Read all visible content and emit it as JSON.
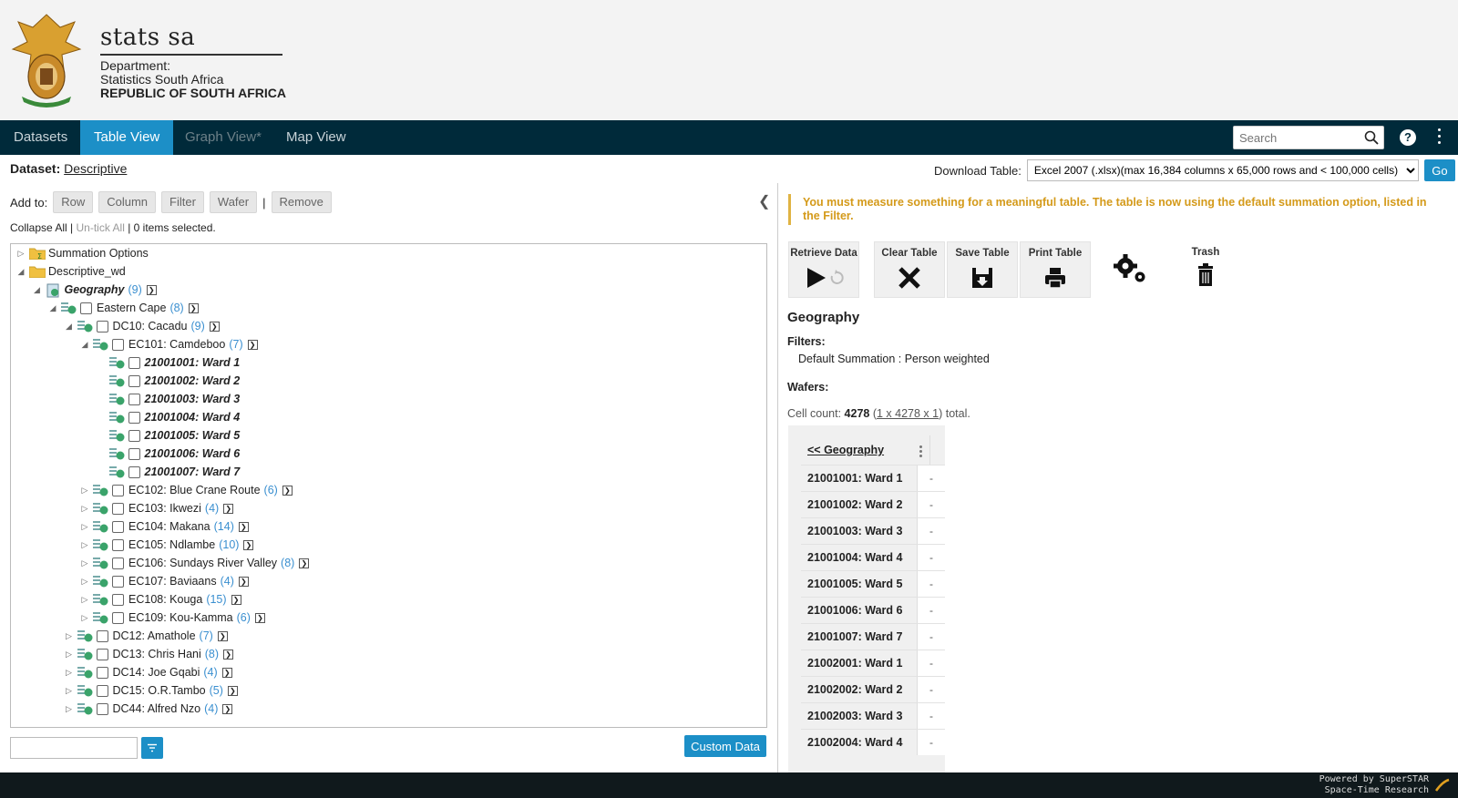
{
  "header": {
    "brand": "stats sa",
    "dept_line1": "Department:",
    "dept_line2": "Statistics South Africa",
    "dept_line3": "REPUBLIC OF SOUTH AFRICA"
  },
  "nav": {
    "tabs": [
      {
        "label": "Datasets",
        "state": "normal"
      },
      {
        "label": "Table View",
        "state": "active"
      },
      {
        "label": "Graph View*",
        "state": "disabled"
      },
      {
        "label": "Map View",
        "state": "normal"
      }
    ],
    "search_placeholder": "Search",
    "help_label": "?"
  },
  "dataset": {
    "label": "Dataset:",
    "name": "Descriptive"
  },
  "download": {
    "label": "Download Table:",
    "selected": "Excel 2007 (.xlsx)(max 16,384 columns x 65,000 rows and < 100,000 cells)",
    "go": "Go"
  },
  "add_to": {
    "label": "Add to:",
    "buttons": [
      "Row",
      "Column",
      "Filter",
      "Wafer"
    ],
    "separator": "|",
    "remove": "Remove"
  },
  "tree_controls": {
    "collapse_all": "Collapse All",
    "untick_all": "Un-tick All",
    "selected_text": "0 items selected."
  },
  "tree": [
    {
      "label": "Summation Options",
      "count": "",
      "style": "normal"
    },
    {
      "label": "Descriptive_wd",
      "count": "",
      "style": "normal"
    },
    {
      "label": "Geography",
      "count": "(9)",
      "style": "bolditalic"
    },
    {
      "label": "Eastern Cape",
      "count": "(8)",
      "style": "normal"
    },
    {
      "label": "DC10: Cacadu",
      "count": "(9)",
      "style": "normal"
    },
    {
      "label": "EC101: Camdeboo",
      "count": "(7)",
      "style": "normal"
    },
    {
      "label": "21001001: Ward 1",
      "count": "",
      "style": "bolditalic"
    },
    {
      "label": "21001002: Ward 2",
      "count": "",
      "style": "bolditalic"
    },
    {
      "label": "21001003: Ward 3",
      "count": "",
      "style": "bolditalic"
    },
    {
      "label": "21001004: Ward 4",
      "count": "",
      "style": "bolditalic"
    },
    {
      "label": "21001005: Ward 5",
      "count": "",
      "style": "bolditalic"
    },
    {
      "label": "21001006: Ward 6",
      "count": "",
      "style": "bolditalic"
    },
    {
      "label": "21001007: Ward 7",
      "count": "",
      "style": "bolditalic"
    },
    {
      "label": "EC102: Blue Crane Route",
      "count": "(6)",
      "style": "normal"
    },
    {
      "label": "EC103: Ikwezi",
      "count": "(4)",
      "style": "normal"
    },
    {
      "label": "EC104: Makana",
      "count": "(14)",
      "style": "normal"
    },
    {
      "label": "EC105: Ndlambe",
      "count": "(10)",
      "style": "normal"
    },
    {
      "label": "EC106: Sundays River Valley",
      "count": "(8)",
      "style": "normal"
    },
    {
      "label": "EC107: Baviaans",
      "count": "(4)",
      "style": "normal"
    },
    {
      "label": "EC108: Kouga",
      "count": "(15)",
      "style": "normal"
    },
    {
      "label": "EC109: Kou-Kamma",
      "count": "(6)",
      "style": "normal"
    },
    {
      "label": "DC12: Amathole",
      "count": "(7)",
      "style": "normal"
    },
    {
      "label": "DC13: Chris Hani",
      "count": "(8)",
      "style": "normal"
    },
    {
      "label": "DC14: Joe Gqabi",
      "count": "(4)",
      "style": "normal"
    },
    {
      "label": "DC15: O.R.Tambo",
      "count": "(5)",
      "style": "normal"
    },
    {
      "label": "DC44: Alfred Nzo",
      "count": "(4)",
      "style": "normal"
    }
  ],
  "custom_data": "Custom Data",
  "warning": "You must measure something for a meaningful table. The table is now using the default summation option, listed in the Filter.",
  "toolbar": {
    "retrieve": "Retrieve Data",
    "clear": "Clear Table",
    "save": "Save Table",
    "print": "Print Table",
    "trash": "Trash"
  },
  "summary": {
    "title": "Geography",
    "filters_label": "Filters:",
    "filters_value": "Default Summation : Person weighted",
    "wafers_label": "Wafers:",
    "cell_count_label": "Cell count:",
    "cell_count_value": "4278",
    "cell_count_dims": "1 x 4278 x 1",
    "cell_count_suffix": "total."
  },
  "table": {
    "header": "<< Geography",
    "rows": [
      {
        "label": "21001001: Ward 1",
        "value": "-"
      },
      {
        "label": "21001002: Ward 2",
        "value": "-"
      },
      {
        "label": "21001003: Ward 3",
        "value": "-"
      },
      {
        "label": "21001004: Ward 4",
        "value": "-"
      },
      {
        "label": "21001005: Ward 5",
        "value": "-"
      },
      {
        "label": "21001006: Ward 6",
        "value": "-"
      },
      {
        "label": "21001007: Ward 7",
        "value": "-"
      },
      {
        "label": "21002001: Ward 1",
        "value": "-"
      },
      {
        "label": "21002002: Ward 2",
        "value": "-"
      },
      {
        "label": "21002003: Ward 3",
        "value": "-"
      },
      {
        "label": "21002004: Ward 4",
        "value": "-"
      }
    ]
  },
  "footer": {
    "line1": "Powered by SuperSTAR",
    "line2": "Space-Time Research"
  },
  "colors": {
    "nav_bg": "#002a3a",
    "accent": "#1c8fc7",
    "warning": "#d49a1a",
    "count": "#3a8fd0"
  }
}
